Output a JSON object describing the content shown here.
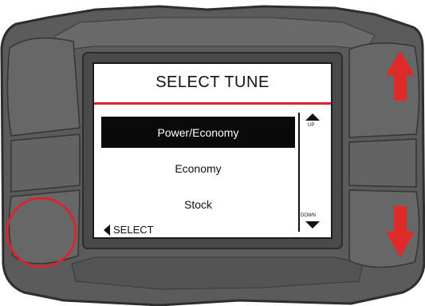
{
  "screen": {
    "title": "SELECT TUNE",
    "menu_items": [
      {
        "label": "Power/Economy",
        "selected": true
      },
      {
        "label": "Economy",
        "selected": false
      },
      {
        "label": "Stock",
        "selected": false
      }
    ],
    "scroll": {
      "up_label": "UP",
      "down_label": "DOWN"
    },
    "softkey_select_label": "SELECT"
  },
  "colors": {
    "device_body": "#5b5b5b",
    "device_edge": "#3a3a3a",
    "screen_bg": "#ffffff",
    "title_rule": "#d8262e",
    "highlight_red": "#e02a2a",
    "selected_row_bg": "#0a0a0a"
  },
  "icons": {
    "scroll_up": "triangle-up-icon",
    "scroll_down": "triangle-down-icon",
    "softkey": "triangle-left-icon",
    "arrow_up_hint": "red-arrow-up-icon",
    "arrow_down_hint": "red-arrow-down-icon",
    "button_highlight": "red-circle-highlight"
  }
}
